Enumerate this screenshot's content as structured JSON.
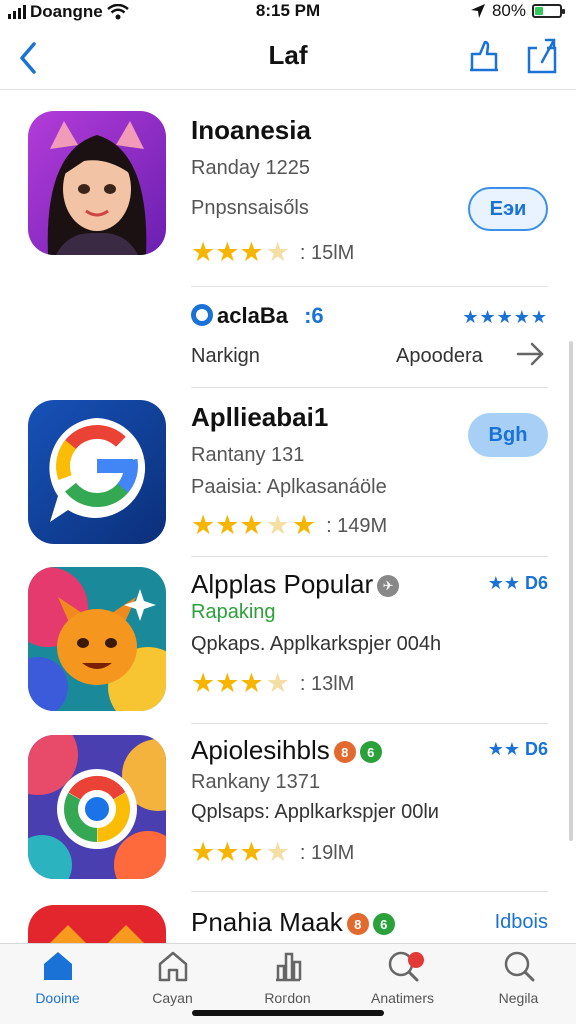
{
  "status_bar": {
    "carrier": "Doangne",
    "time": "8:15 PM",
    "battery": "80%"
  },
  "nav": {
    "title": "Laf"
  },
  "apps": [
    {
      "name": "Inoanesia",
      "line1": "Randay 1225",
      "line2": "Pnpsnsaisőls",
      "rating_count": ": 15lM",
      "button": "Eэи"
    },
    {
      "name": "Apllieabai1",
      "line1": "Rantany 131",
      "line2": "Paaisia: Aplkasanáöle",
      "rating_count": ": 149M",
      "button": "Bgh"
    },
    {
      "name": "Alpplas Popular",
      "line1": "Rapaking",
      "line2": "Qpkaps. Applkarkspjer 004h",
      "rating_count": ": 13lM",
      "side": "★★ D6"
    },
    {
      "name": "Apiolesihbls",
      "line1": "Rankany 1371",
      "line2": "Qplsaps: Applkarkspjer 00lи",
      "rating_count": ": 19lM",
      "side": "★★ D6"
    },
    {
      "name": "Pnahia Mаak",
      "side": "Idbois"
    }
  ],
  "promo": {
    "title": "aclaBa",
    "tag": ":6",
    "stars": "★★★★★",
    "left": "Narkign",
    "right": "Apoodera"
  },
  "badges": {
    "a": "8",
    "b": "6"
  },
  "tabs": [
    {
      "label": "Doоine"
    },
    {
      "label": "Cayan"
    },
    {
      "label": "Roгdon"
    },
    {
      "label": "Anatimers"
    },
    {
      "label": "Negila"
    }
  ],
  "colors": {
    "accent": "#1a72d6",
    "star": "#f7b500",
    "green": "#2aa13a"
  }
}
